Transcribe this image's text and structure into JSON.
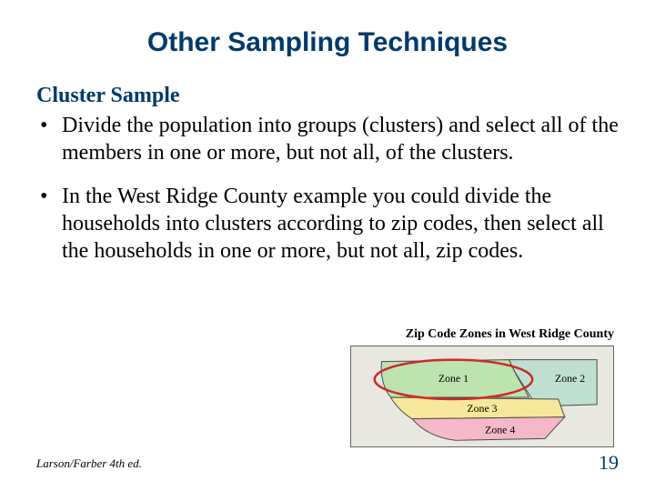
{
  "title": "Other Sampling Techniques",
  "subtitle": "Cluster Sample",
  "bullets": {
    "b1": "Divide the population into groups (clusters) and select all of the members in one or more, but not all, of the clusters.",
    "b2": "In the West Ridge County example you could divide the households into clusters according to zip codes, then select all the households in one or more, but not all, zip codes."
  },
  "figure": {
    "title": "Zip Code Zones in West Ridge County",
    "zone1": "Zone 1",
    "zone2": "Zone 2",
    "zone3": "Zone 3",
    "zone4": "Zone 4"
  },
  "footer": {
    "left": "Larson/Farber 4th ed.",
    "page": "19"
  }
}
